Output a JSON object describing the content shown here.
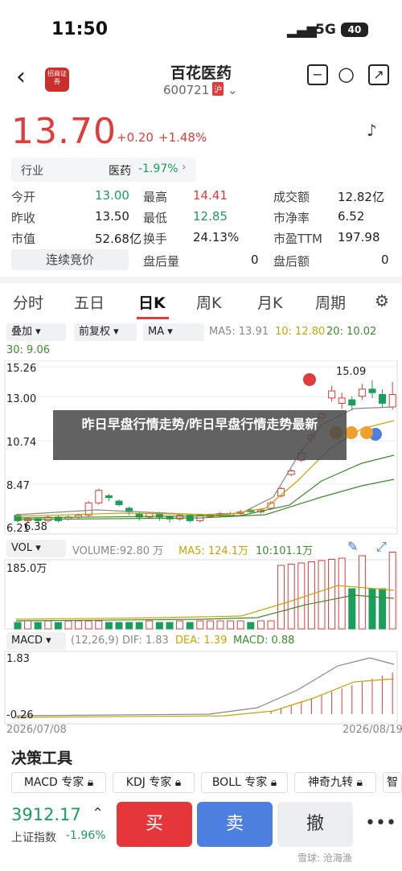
{
  "status": {
    "time": "11:50",
    "net": "5G",
    "battery": "40"
  },
  "header": {
    "broker": "招商证券",
    "name": "百花医药",
    "code": "600721",
    "market": "沪"
  },
  "quote": {
    "price": "13.70",
    "change": "+0.20",
    "pct": "+1.48%"
  },
  "industry": {
    "label": "行业",
    "name": "医药",
    "pct": "-1.97%"
  },
  "stats": [
    {
      "l": "今开",
      "v": "13.00",
      "c": "green"
    },
    {
      "l": "最高",
      "v": "14.41",
      "c": "red"
    },
    {
      "l": "成交额",
      "v": "12.82亿",
      "c": ""
    },
    {
      "l": "昨收",
      "v": "13.50",
      "c": ""
    },
    {
      "l": "最低",
      "v": "12.85",
      "c": "green"
    },
    {
      "l": "市净率",
      "v": "6.52",
      "c": ""
    },
    {
      "l": "市值",
      "v": "52.68亿",
      "c": ""
    },
    {
      "l": "换手",
      "v": "24.13%",
      "c": ""
    },
    {
      "l": "市盈TTM",
      "v": "197.98",
      "c": ""
    }
  ],
  "auction": "连续竞价",
  "after": {
    "l1": "盘后量",
    "v1": "0",
    "l2": "盘后额",
    "v2": "0"
  },
  "tabs": [
    "分时",
    "五日",
    "日K",
    "周K",
    "月K",
    "周期"
  ],
  "controls": {
    "overlay": "叠加",
    "adjust": "前复权",
    "ma": "MA",
    "ma5": "MA5: 13.91",
    "ma10": "10: 12.80",
    "ma20": "20: 10.02",
    "ma30": "30: 9.06"
  },
  "price_axis": [
    "15.26",
    "13.00",
    "10.74",
    "8.47",
    "6.21"
  ],
  "price_marks": {
    "high": "15.09",
    "low": "6.38",
    "b": "B",
    "s": "S",
    "t": "T"
  },
  "vol": {
    "sel": "VOL",
    "label": "VOLUME:92.80 万",
    "ma5": "MA5: 124.1万",
    "ma10": "10:101.1万",
    "max": "185.0万"
  },
  "macd": {
    "sel": "MACD",
    "params": "(12,26,9)",
    "dif": "DIF: 1.83",
    "dea": "DEA: 1.39",
    "macd": "MACD: 0.88",
    "top": "1.83",
    "bot": "-0.26"
  },
  "dates": {
    "start": "2026/07/08",
    "end": "2026/08/19"
  },
  "watermark": "昨日早盘行情走势/昨日早盘行情走势最新",
  "tools": {
    "title": "决策工具",
    "chips": [
      "MACD 专家",
      "KDJ 专家",
      "BOLL 专家",
      "神奇九转",
      "智"
    ]
  },
  "bottom": {
    "index_value": "3912.17",
    "index_name": "上证指数",
    "index_pct": "-1.96%",
    "buy": "买",
    "sell": "卖",
    "cancel": "撤",
    "footer": "雪球: 沧海渔"
  },
  "chart_data": {
    "type": "candlestick",
    "ma_values": {
      "MA5": 13.91,
      "MA10": 12.8,
      "MA20": 10.02,
      "MA30": 9.06
    },
    "ylim": [
      6.21,
      15.26
    ],
    "x_range": [
      "2026/07/08",
      "2026/08/19"
    ]
  }
}
